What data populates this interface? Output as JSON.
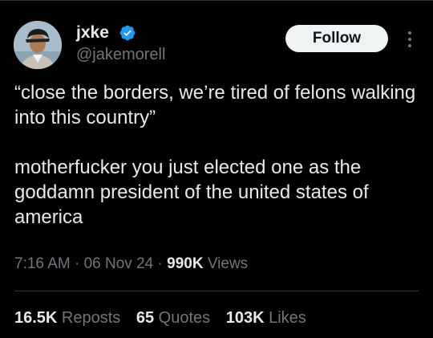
{
  "author": {
    "display_name": "jxke",
    "handle": "@jakemorell",
    "verified": true,
    "verified_color": "#1d9bf0"
  },
  "follow_button": {
    "label": "Follow"
  },
  "more_menu": {
    "icon": "more-vertical-icon"
  },
  "tweet": {
    "paragraph_1": "“close the borders, we’re tired of felons walking into this country”",
    "paragraph_2": "motherfucker you just elected one as the goddamn president of the united states of america"
  },
  "meta": {
    "time": "7:16 AM",
    "separator_1": " · ",
    "date": "06 Nov 24",
    "separator_2": " · ",
    "views_count": "990K",
    "views_label": " Views"
  },
  "stats": {
    "reposts": {
      "count": "16.5K",
      "label": " Reposts"
    },
    "quotes": {
      "count": "65",
      "label": " Quotes"
    },
    "likes": {
      "count": "103K",
      "label": " Likes"
    }
  },
  "colors": {
    "background": "#000000",
    "text_primary": "#e7e9ea",
    "text_secondary": "#71767b",
    "divider": "#2f3336",
    "button_bg": "#eff3f4"
  }
}
